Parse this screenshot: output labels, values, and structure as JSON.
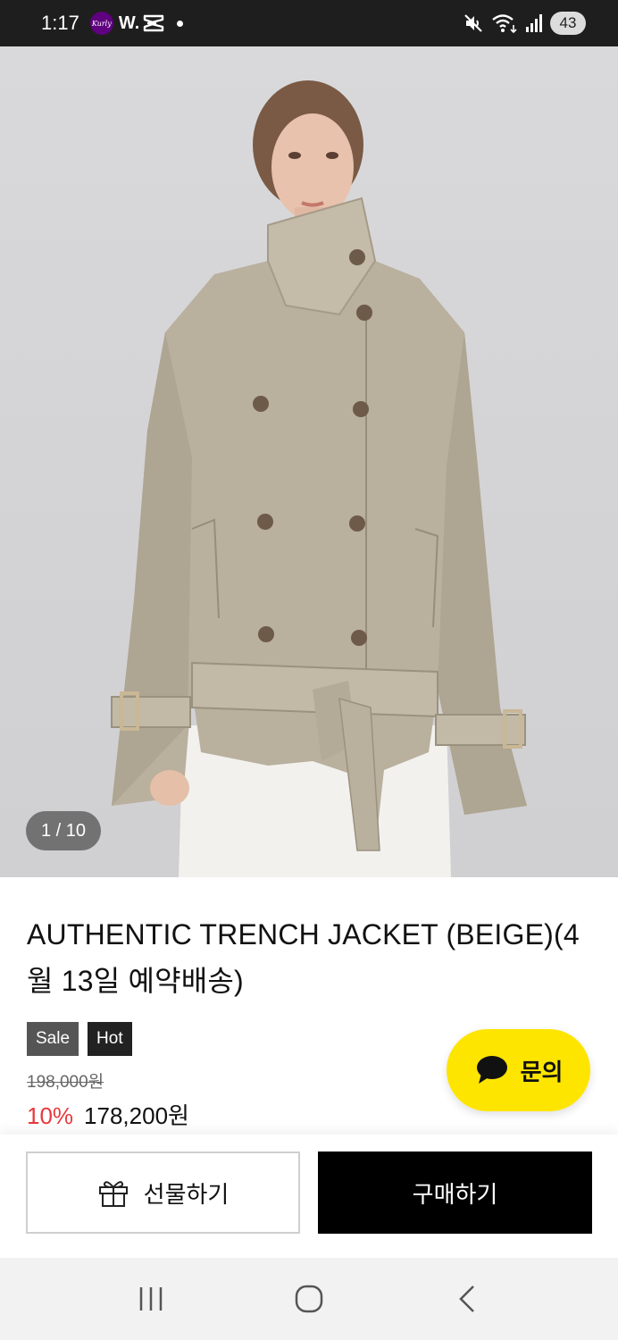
{
  "status_bar": {
    "time": "1:17",
    "kurly_label": "Kurly",
    "w_label": "W.",
    "battery": "43",
    "icons": [
      "kurly-app-icon",
      "w-app-icon",
      "capcut-icon",
      "notification-dot-icon",
      "mute-icon",
      "wifi-icon",
      "signal-icon",
      "battery-icon"
    ]
  },
  "gallery": {
    "counter": "1 / 10"
  },
  "product": {
    "title": "AUTHENTIC TRENCH JACKET (BEIGE)(4월 13일 예약배송)",
    "badges": [
      "Sale",
      "Hot"
    ],
    "original_price": "198,000원",
    "discount": "10%",
    "sale_price": "178,200원"
  },
  "inquiry": {
    "label": "문의"
  },
  "actions": {
    "gift_label": "선물하기",
    "buy_label": "구매하기"
  },
  "colors": {
    "inquiry_bg": "#fee500",
    "discount": "#e8393d",
    "buy_bg": "#000000",
    "coat": "#b9b09e"
  }
}
